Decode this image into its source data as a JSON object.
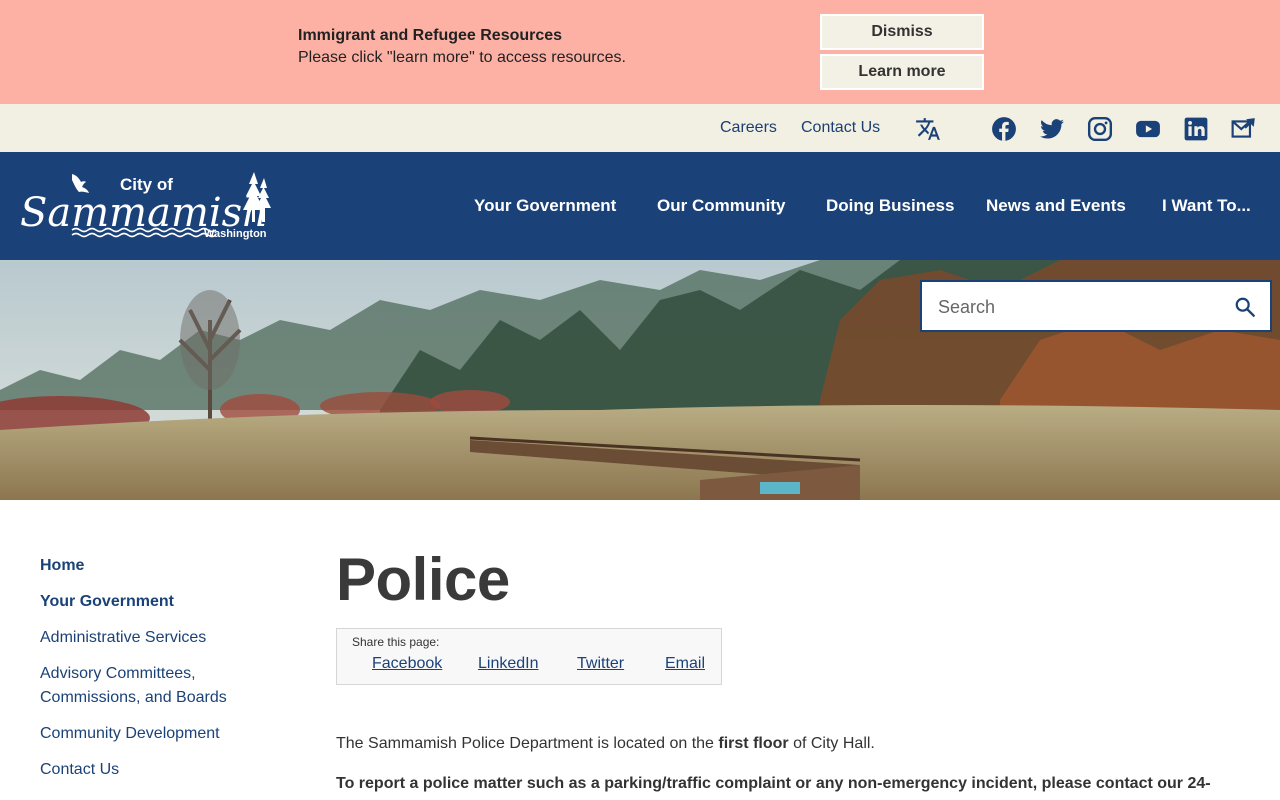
{
  "alert": {
    "title": "Immigrant and Refugee Resources",
    "body": "Please click \"learn more\" to access resources.",
    "dismiss_label": "Dismiss",
    "learn_more_label": "Learn more"
  },
  "utility": {
    "careers_label": "Careers",
    "contact_label": "Contact Us",
    "icons": [
      "translate-icon",
      "facebook-icon",
      "twitter-icon",
      "instagram-icon",
      "youtube-icon",
      "linkedin-icon",
      "email-subscribe-icon"
    ]
  },
  "header": {
    "logo_text_top": "City of",
    "logo_text_main": "Sammamish",
    "logo_text_sub": "Washington",
    "nav": [
      "Your Government",
      "Our Community",
      "Doing Business",
      "News and Events",
      "I Want To..."
    ]
  },
  "search": {
    "placeholder": "Search"
  },
  "sidebar": {
    "items": [
      {
        "label": "Home"
      },
      {
        "label": "Your Government"
      },
      {
        "label": "Administrative Services"
      },
      {
        "label": "Advisory Committees, Commissions, and Boards"
      },
      {
        "label": "Community Development"
      },
      {
        "label": "Contact Us"
      }
    ]
  },
  "main": {
    "title": "Police",
    "share": {
      "label": "Share this page:",
      "links": [
        "Facebook",
        "LinkedIn",
        "Twitter",
        "Email"
      ]
    },
    "para1_pre": "The Sammamish Police Department is located on the ",
    "para1_bold": "first floor",
    "para1_post": " of City Hall.",
    "para2": "To report a police matter such as a parking/traffic complaint or any non-emergency incident, please contact our 24-"
  },
  "colors": {
    "alert_bg": "#fdb1a5",
    "utility_bg": "#f2f0e3",
    "header_bg": "#1b4278",
    "link": "#1b4278"
  }
}
